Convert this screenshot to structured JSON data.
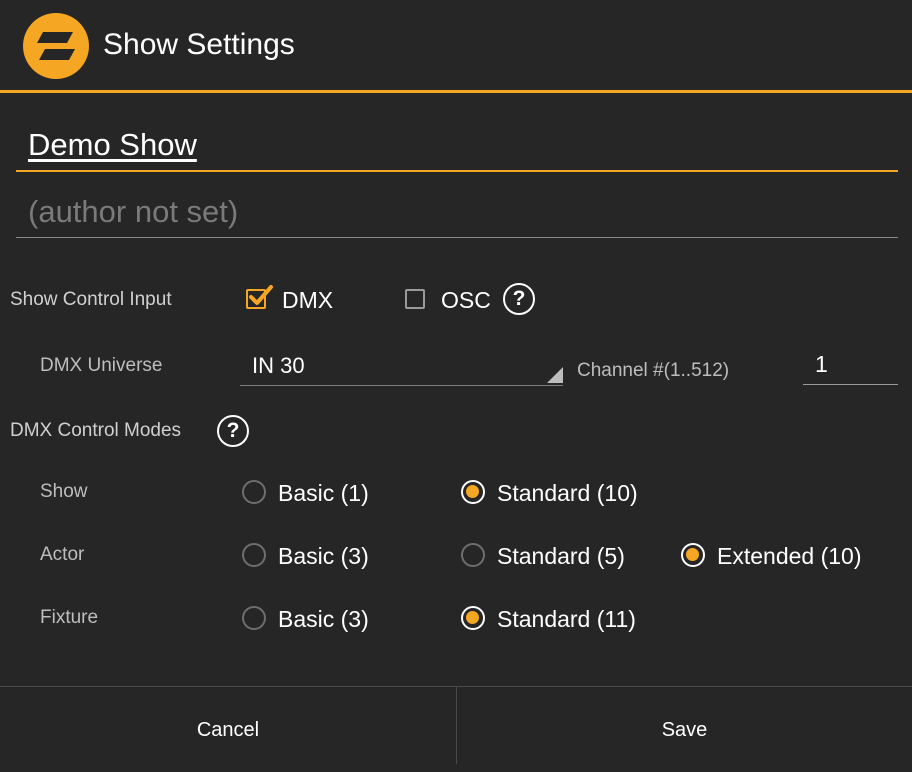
{
  "dialog": {
    "title": "Show Settings",
    "logo_icon": "lightning-logo-icon"
  },
  "show_name": {
    "value": "Demo Show"
  },
  "author": {
    "value": "",
    "placeholder": "(author not set)"
  },
  "show_control_input": {
    "label": "Show Control Input",
    "dmx": {
      "label": "DMX",
      "checked": true
    },
    "osc": {
      "label": "OSC",
      "checked": false
    },
    "help_glyph": "?"
  },
  "dmx_universe": {
    "label": "DMX Universe",
    "selected": "IN 30",
    "channel_label": "Channel #(1..512)",
    "channel_value": "1"
  },
  "dmx_control_modes": {
    "label": "DMX Control Modes",
    "help_glyph": "?",
    "rows": [
      {
        "label": "Show",
        "options": [
          {
            "label": "Basic (1)",
            "selected": false
          },
          {
            "label": "Standard (10)",
            "selected": true
          }
        ]
      },
      {
        "label": "Actor",
        "options": [
          {
            "label": "Basic (3)",
            "selected": false
          },
          {
            "label": "Standard (5)",
            "selected": false
          },
          {
            "label": "Extended (10)",
            "selected": true
          }
        ]
      },
      {
        "label": "Fixture",
        "options": [
          {
            "label": "Basic (3)",
            "selected": false
          },
          {
            "label": "Standard (11)",
            "selected": true
          }
        ]
      }
    ]
  },
  "footer": {
    "cancel_label": "Cancel",
    "save_label": "Save"
  },
  "colors": {
    "accent": "#f5a623",
    "background": "#262626"
  }
}
